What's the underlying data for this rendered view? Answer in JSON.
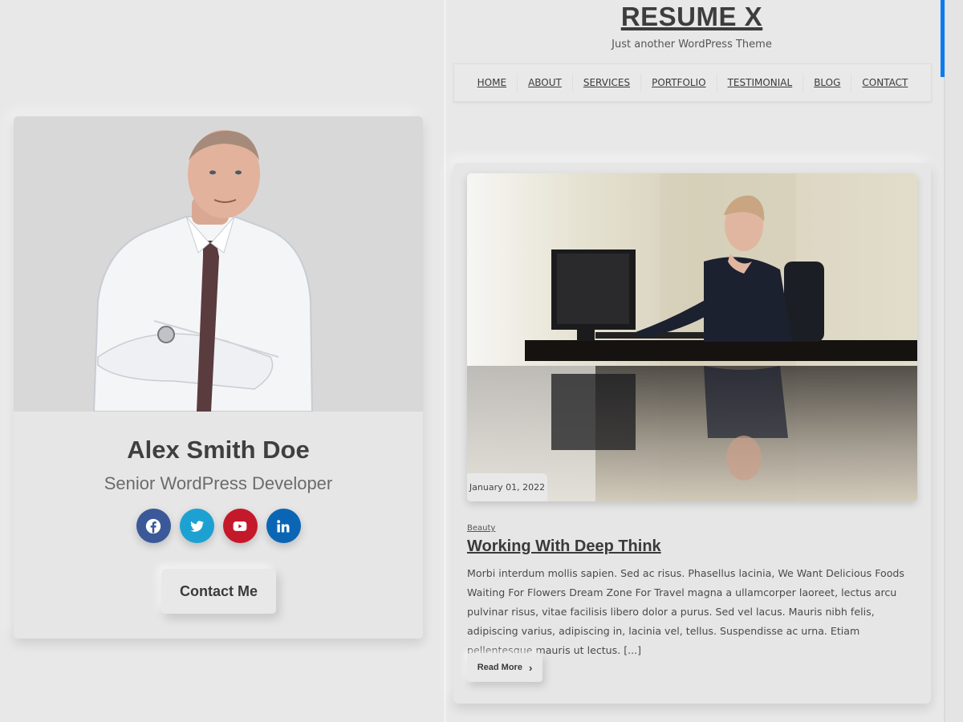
{
  "site": {
    "title": "RESUME X",
    "tagline": "Just another WordPress Theme"
  },
  "nav": {
    "items": [
      {
        "label": "HOME"
      },
      {
        "label": "ABOUT"
      },
      {
        "label": "SERVICES"
      },
      {
        "label": "PORTFOLIO"
      },
      {
        "label": "TESTIMONIAL"
      },
      {
        "label": "BLOG"
      },
      {
        "label": "CONTACT"
      }
    ]
  },
  "profile": {
    "name": "Alex Smith Doe",
    "role": "Senior WordPress Developer",
    "contact_label": "Contact Me",
    "socials": [
      {
        "name": "facebook",
        "icon": "facebook-icon",
        "color": "#3b5998"
      },
      {
        "name": "twitter",
        "icon": "twitter-icon",
        "color": "#1da1d2"
      },
      {
        "name": "youtube",
        "icon": "youtube-icon",
        "color": "#c4192a"
      },
      {
        "name": "linkedin",
        "icon": "linkedin-icon",
        "color": "#0a66b5"
      }
    ]
  },
  "post": {
    "date": "January 01, 2022",
    "category": "Beauty",
    "title": "Working With Deep Think",
    "excerpt": "Morbi interdum mollis sapien. Sed ac risus. Phasellus lacinia, We Want Delicious Foods Waiting For Flowers Dream Zone For Travel magna a ullamcorper laoreet, lectus arcu pulvinar risus, vitae facilisis libero dolor a purus. Sed vel lacus. Mauris nibh felis, adipiscing varius, adipiscing in, lacinia vel, tellus. Suspendisse ac urna. Etiam pellentesque mauris ut lectus. [...]",
    "read_more_label": "Read More",
    "read_more_icon": "chevron-right-icon"
  },
  "colors": {
    "background": "#e8e8e8",
    "scrollbar_accent": "#0a7cf0"
  }
}
